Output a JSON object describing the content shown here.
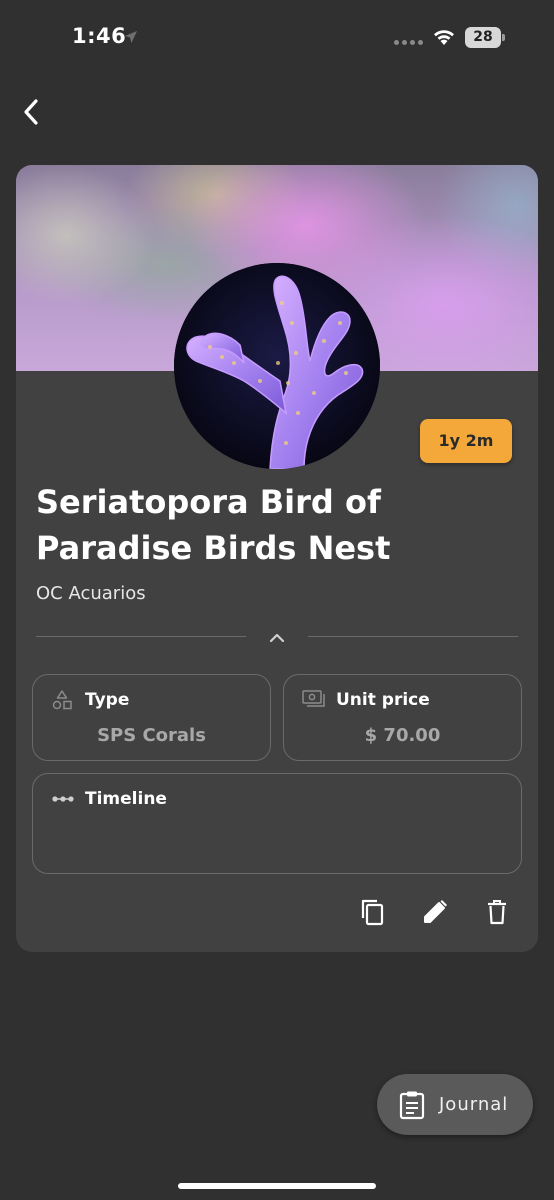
{
  "status_bar": {
    "time": "1:46",
    "battery": "28"
  },
  "coral": {
    "age": "1y 2m",
    "name": "Seriatopora Bird of Paradise Birds Nest",
    "vendor": "OC Acuarios"
  },
  "details": {
    "type_label": "Type",
    "type_value": "SPS Corals",
    "price_label": "Unit price",
    "price_value": "$ 70.00",
    "timeline_label": "Timeline"
  },
  "fab": {
    "label": "Journal"
  },
  "colors": {
    "background": "#303030",
    "card": "#414141",
    "badge": "#f4a83a",
    "muted_text": "#a8a8a8"
  },
  "icons": [
    "location-arrow-icon",
    "wifi-icon",
    "battery-icon",
    "back-chevron-icon",
    "chevron-up-icon",
    "shapes-icon",
    "cash-icon",
    "timeline-icon",
    "copy-icon",
    "pencil-icon",
    "trash-icon",
    "clipboard-icon"
  ]
}
